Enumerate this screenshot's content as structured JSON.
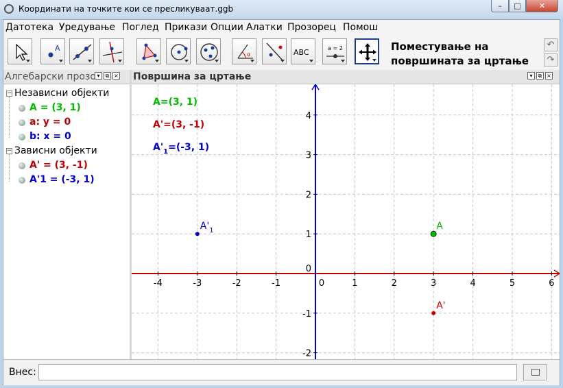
{
  "window": {
    "title": "Координати на точките кои се пресликуваат.ggb",
    "min_label": "–",
    "max_label": "□",
    "close_label": "✕"
  },
  "menu": [
    "Датотека",
    "Уредување",
    "Поглед",
    "Прикази",
    "Опции",
    "Алатки",
    "Прозорец",
    "Помош"
  ],
  "toolbar": {
    "tools": [
      "move-tool",
      "new-point-tool",
      "line-tool",
      "perpendicular-line-tool",
      "polygon-tool",
      "circle-tool",
      "conic-tool",
      "angle-tool",
      "reflect-tool",
      "text-tool",
      "slider-tool",
      "move-graphics-tool"
    ],
    "text_tool_label": "ABC",
    "slider_tool_label": "a = 2",
    "help_line1": "Поместување на",
    "help_line2": "површината за цртање",
    "undo_icon": "undo-icon",
    "redo_icon": "redo-icon"
  },
  "algebra": {
    "title": "Алгебарски прозорец",
    "groups": [
      {
        "label": "Независни објекти",
        "toggle": "−",
        "items": [
          {
            "label": "A = (3, 1)",
            "color": "#00bb00"
          },
          {
            "label": "a: y = 0",
            "color": "#c00000"
          },
          {
            "label": "b: x = 0",
            "color": "#0000cc"
          }
        ]
      },
      {
        "label": "Зависни објекти",
        "toggle": "−",
        "items": [
          {
            "label": "A' = (3, -1)",
            "color": "#c00000"
          },
          {
            "label": "A'1 = (-3, 1)",
            "color": "#0000cc"
          }
        ]
      }
    ]
  },
  "graphics": {
    "title": "Површина за цртање",
    "x_ticks": [
      "-4",
      "-3",
      "-2",
      "-1",
      "0",
      "1",
      "2",
      "3",
      "4",
      "5",
      "6"
    ],
    "y_ticks": [
      "-2",
      "-1",
      "0",
      "1",
      "2",
      "3",
      "4"
    ],
    "x_axis_color": "#c00000",
    "y_axis_color": "#0000cc",
    "texts": [
      {
        "label": "A=(3, 1)",
        "color": "#00bb00"
      },
      {
        "label": "A'=(3, -1)",
        "color": "#c00000"
      },
      {
        "label": "A'1=(-3, 1)",
        "color": "#0000cc"
      }
    ],
    "points": [
      {
        "name": "A",
        "x": 3,
        "y": 1,
        "color": "#00bb00"
      },
      {
        "name": "A'",
        "x": 3,
        "y": -1,
        "color": "#c00000"
      },
      {
        "name": "A'1",
        "x": -3,
        "y": 1,
        "color": "#0000cc"
      }
    ]
  },
  "input": {
    "label": "Внес:",
    "value": ""
  }
}
